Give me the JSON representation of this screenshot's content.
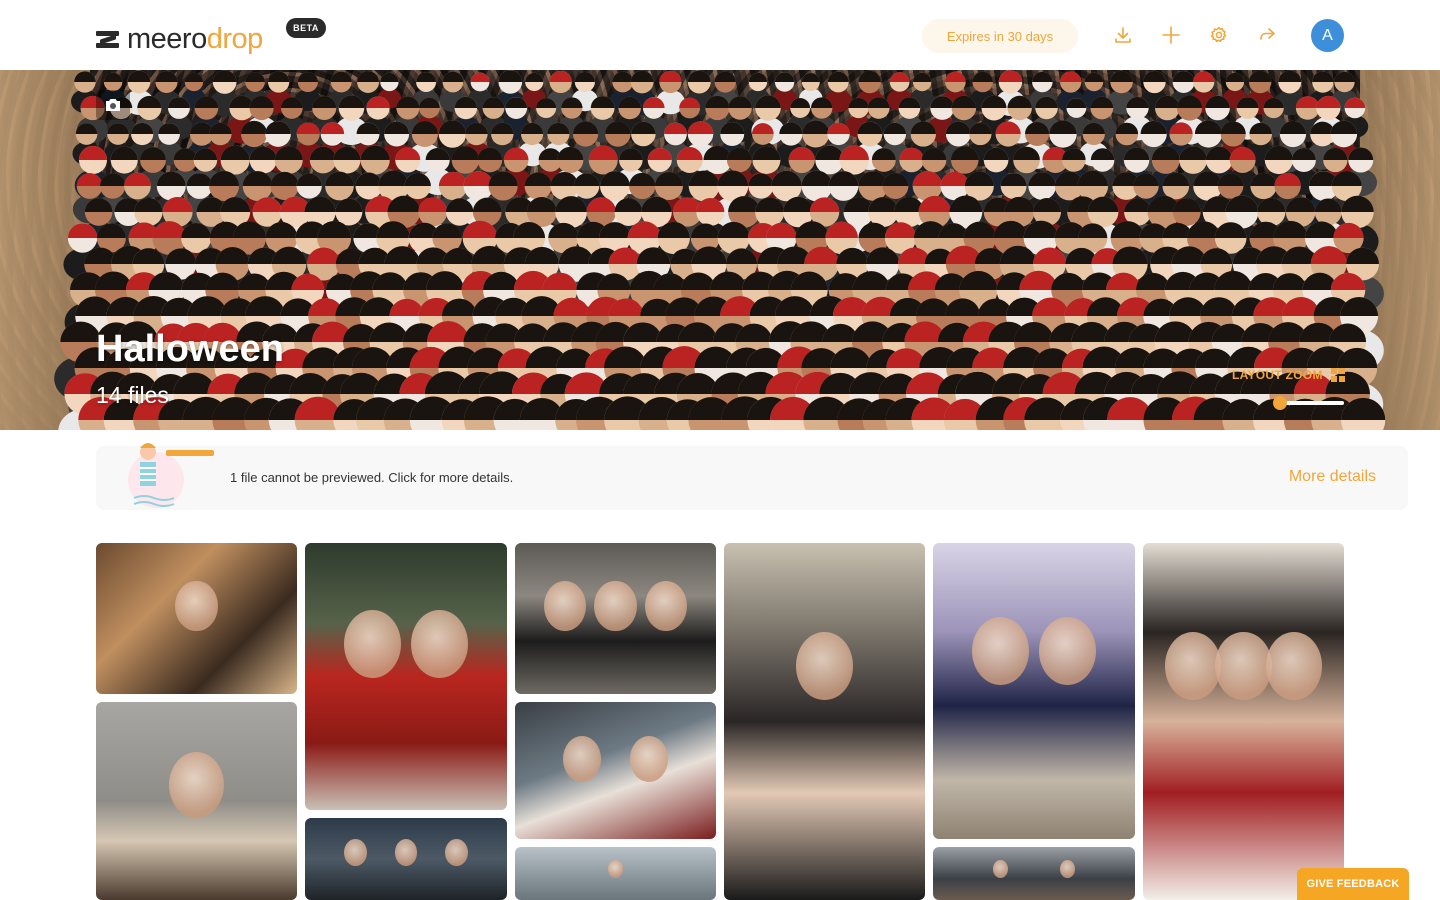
{
  "header": {
    "logo_part1": "meero",
    "logo_part2": "drop",
    "beta": "BETA",
    "expires": "Expires in 30 days",
    "avatar_initial": "A"
  },
  "hero": {
    "title": "Halloween",
    "file_count": "14 files",
    "layout_zoom_label": "LAYOUT ZOOM",
    "layout_zoom_level": 0
  },
  "notice": {
    "text": "1 file cannot be previewed. Click for more details.",
    "link": "More details"
  },
  "feedback": {
    "label": "GIVE FEEDBACK"
  },
  "colors": {
    "accent": "#f0a63a",
    "avatar": "#3d8fd9",
    "dark": "#2b2b2b"
  },
  "gallery": {
    "photos": [
      {
        "name": "photo-1",
        "tone": "warm-portrait"
      },
      {
        "name": "photo-2",
        "tone": "red-jumpsuits"
      },
      {
        "name": "photo-3",
        "tone": "group-office"
      },
      {
        "name": "photo-4",
        "tone": "selfie-crowd"
      },
      {
        "name": "photo-5",
        "tone": "office-costume"
      },
      {
        "name": "photo-6",
        "tone": "clown-selfie"
      },
      {
        "name": "photo-7",
        "tone": "fur-coat"
      },
      {
        "name": "photo-8",
        "tone": "joker"
      },
      {
        "name": "photo-9",
        "tone": "office-desk"
      },
      {
        "name": "photo-10",
        "tone": "hallway"
      },
      {
        "name": "photo-11",
        "tone": "crowd-hall"
      }
    ]
  }
}
